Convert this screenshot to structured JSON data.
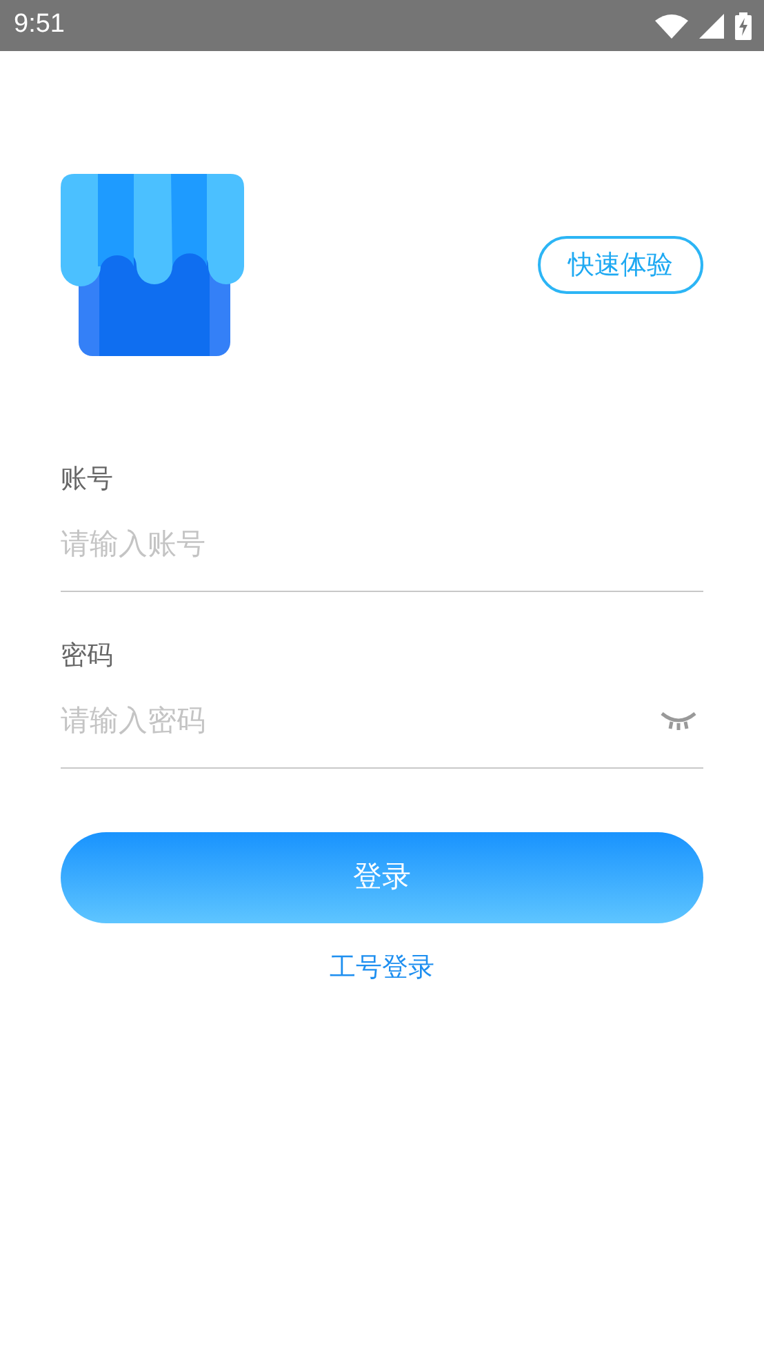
{
  "status_bar": {
    "time": "9:51"
  },
  "quick_try_button": "快速体验",
  "account": {
    "label": "账号",
    "placeholder": "请输入账号"
  },
  "password": {
    "label": "密码",
    "placeholder": "请输入密码"
  },
  "login_button": "登录",
  "employee_login_link": "工号登录"
}
